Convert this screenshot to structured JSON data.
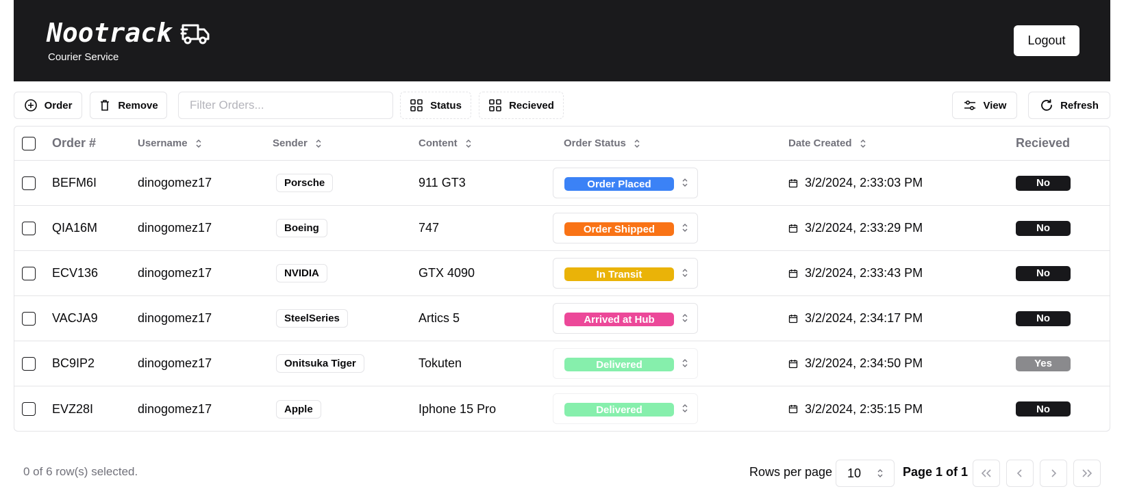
{
  "header": {
    "brand": "Nootrack",
    "subtitle": "Courier Service",
    "logout_label": "Logout"
  },
  "toolbar": {
    "order_label": "Order",
    "remove_label": "Remove",
    "filter_placeholder": "Filter Orders...",
    "status_label": "Status",
    "received_label": "Recieved",
    "view_label": "View",
    "refresh_label": "Refresh"
  },
  "table": {
    "columns": {
      "order": "Order #",
      "username": "Username",
      "sender": "Sender",
      "content": "Content",
      "status": "Order Status",
      "date": "Date Created",
      "received": "Recieved"
    },
    "rows": [
      {
        "order": "BEFM6I",
        "username": "dinogomez17",
        "sender": "Porsche",
        "content": "911 GT3",
        "status": "Order Placed",
        "status_color": "#3b82f6",
        "date": "3/2/2024, 2:33:03 PM",
        "received": "No",
        "received_color": "#18181b"
      },
      {
        "order": "QIA16M",
        "username": "dinogomez17",
        "sender": "Boeing",
        "content": "747",
        "status": "Order Shipped",
        "status_color": "#f97316",
        "date": "3/2/2024, 2:33:29 PM",
        "received": "No",
        "received_color": "#18181b"
      },
      {
        "order": "ECV136",
        "username": "dinogomez17",
        "sender": "NVIDIA",
        "content": "GTX 4090",
        "status": "In Transit",
        "status_color": "#eab308",
        "date": "3/2/2024, 2:33:43 PM",
        "received": "No",
        "received_color": "#18181b"
      },
      {
        "order": "VACJA9",
        "username": "dinogomez17",
        "sender": "SteelSeries",
        "content": "Artics 5",
        "status": "Arrived at Hub",
        "status_color": "#ec4899",
        "date": "3/2/2024, 2:34:17 PM",
        "received": "No",
        "received_color": "#18181b"
      },
      {
        "order": "BC9IP2",
        "username": "dinogomez17",
        "sender": "Onitsuka Tiger",
        "content": "Tokuten",
        "status": "Delivered",
        "status_color": "#86efac",
        "date": "3/2/2024, 2:34:50 PM",
        "received": "Yes",
        "received_color": "#8a8a8d"
      },
      {
        "order": "EVZ28I",
        "username": "dinogomez17",
        "sender": "Apple",
        "content": "Iphone 15 Pro",
        "status": "Delivered",
        "status_color": "#86efac",
        "date": "3/2/2024, 2:35:15 PM",
        "received": "No",
        "received_color": "#18181b"
      }
    ]
  },
  "footer": {
    "selection": "0 of 6 row(s) selected.",
    "rows_per_page_label": "Rows per page",
    "rows_per_page_value": "10",
    "page_label": "Page 1 of 1"
  }
}
